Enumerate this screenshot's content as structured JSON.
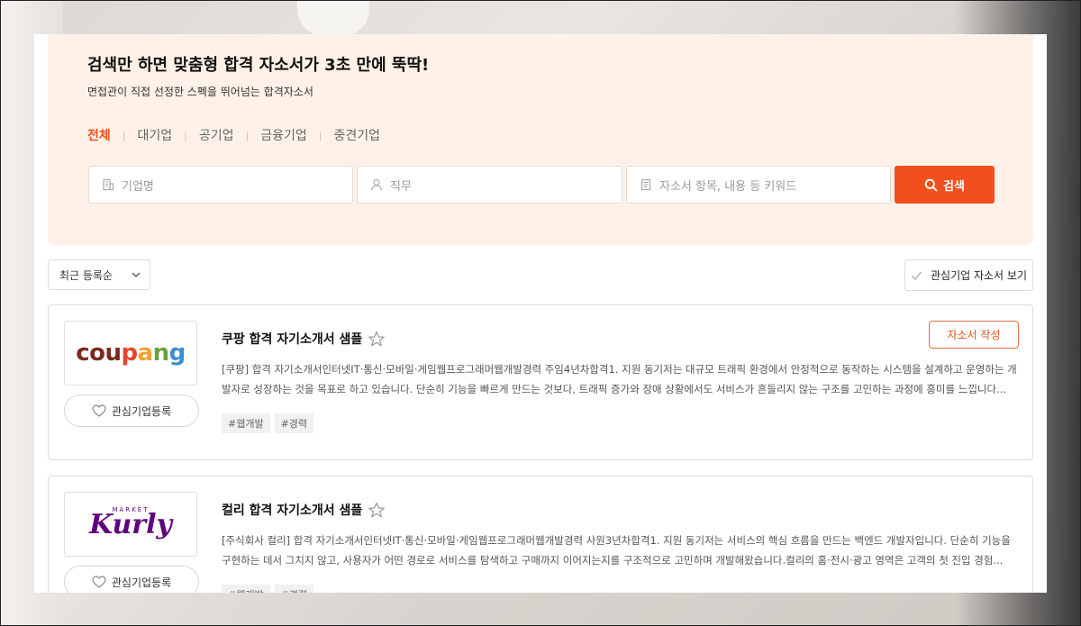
{
  "hero": {
    "title": "검색만 하면 맞춤형 합격 자소서가 3초 만에 뚝딱!",
    "subtitle": "면접관이 직접 선정한 스펙을 뛰어넘는 합격자소서",
    "tabs": [
      {
        "label": "전체",
        "active": true
      },
      {
        "label": "대기업",
        "active": false
      },
      {
        "label": "공기업",
        "active": false
      },
      {
        "label": "금융기업",
        "active": false
      },
      {
        "label": "중견기업",
        "active": false
      }
    ],
    "search": {
      "company_placeholder": "기업명",
      "job_placeholder": "직무",
      "keyword_placeholder": "자소서 항목, 내용 등 키워드",
      "button_label": "검색"
    }
  },
  "toolbar": {
    "sort_label": "최근 등록순",
    "interest_label": "관심기업 자소서 보기"
  },
  "cards": [
    {
      "logo_text": [
        "cou",
        "p",
        "a",
        "n",
        "g"
      ],
      "favorite_label": "관심기업등록",
      "title": "쿠팡 합격 자기소개서 샘플",
      "description": "[쿠팡] 합격 자기소개서인터넷IT·통신·모바일·게임웹프로그래머웹개발경력 주임4년차합격1. 지원 동기저는 대규모 트래픽 환경에서 안정적으로 동작하는 시스템을 설계하고 운영하는 개발자로 성장하는 것을 목표로 하고 있습니다. 단순히 기능을 빠르게 만드는 것보다, 트래픽 증가와 장애 상황에서도 서비스가 흔들리지 않는 구조를 고민하는 과정에 흥미를 느낍니다...",
      "tags": [
        "#웹개발",
        "#경력"
      ],
      "write_label": "자소서 작성"
    },
    {
      "logo_top": "MARKET",
      "logo_text": "Kurly",
      "favorite_label": "관심기업등록",
      "title": "컬리 합격 자기소개서 샘플",
      "description": "[주식회사 컬리] 합격 자기소개서인터넷IT·통신·모바일·게임웹프로그래머웹개발경력 사원3년차합격1. 지원 동기저는 서비스의 핵심 흐름을 만드는 백엔드 개발자입니다. 단순히 기능을 구현하는 데서 그치지 않고, 사용자가 어떤 경로로 서비스를 탐색하고 구매까지 이어지는지를 구조적으로 고민하며 개발해왔습니다.컬리의 홈·전시·광고 영역은 고객의 첫 진입 경험...",
      "tags": [
        "#웹개발",
        "#경력"
      ]
    }
  ],
  "colors": {
    "accent": "#f0501e",
    "hero_bg": "#fff1e8",
    "kurly_purple": "#5f0080"
  }
}
